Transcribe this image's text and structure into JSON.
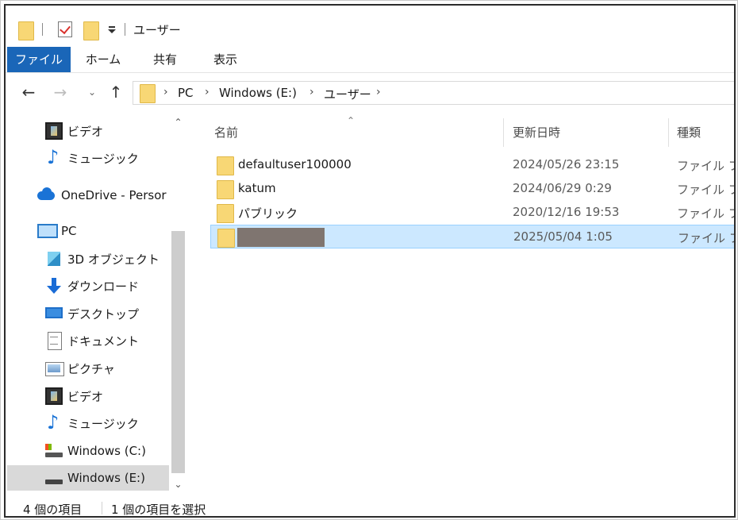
{
  "window": {
    "title": "ユーザー"
  },
  "ribbon": {
    "tabs": [
      "ファイル",
      "ホーム",
      "共有",
      "表示"
    ]
  },
  "address": {
    "crumbs": [
      "PC",
      "Windows (E:)",
      "ユーザー"
    ]
  },
  "sidebar": {
    "items": [
      {
        "label": "ビデオ",
        "icon": "video-icon"
      },
      {
        "label": "ミュージック",
        "icon": "music-icon"
      },
      {
        "label": "OneDrive - Persor",
        "icon": "onedrive-icon"
      },
      {
        "label": "PC",
        "icon": "pc-icon"
      },
      {
        "label": "3D オブジェクト",
        "icon": "3d-objects-icon"
      },
      {
        "label": "ダウンロード",
        "icon": "download-icon"
      },
      {
        "label": "デスクトップ",
        "icon": "desktop-icon"
      },
      {
        "label": "ドキュメント",
        "icon": "documents-icon"
      },
      {
        "label": "ピクチャ",
        "icon": "pictures-icon"
      },
      {
        "label": "ビデオ",
        "icon": "video-icon"
      },
      {
        "label": "ミュージック",
        "icon": "music-icon"
      },
      {
        "label": "Windows (C:)",
        "icon": "drive-c-icon"
      },
      {
        "label": "Windows (E:)",
        "icon": "drive-e-icon"
      }
    ]
  },
  "columns": {
    "name": "名前",
    "date": "更新日時",
    "type": "種類"
  },
  "files": [
    {
      "name": "defaultuser100000",
      "date": "2024/05/26 23:15",
      "type": "ファイル フォ"
    },
    {
      "name": "katum",
      "date": "2024/06/29 0:29",
      "type": "ファイル フォ"
    },
    {
      "name": "パブリック",
      "date": "2020/12/16 19:53",
      "type": "ファイル フォ"
    },
    {
      "name": "",
      "date": "2025/05/04 1:05",
      "type": "ファイル フォ",
      "redacted": true
    }
  ],
  "status": {
    "count": "4 個の項目",
    "selected": "1 個の項目を選択"
  },
  "colors": {
    "accent": "#1a66b8",
    "selection": "#cce8ff",
    "folder": "#f8d775"
  }
}
